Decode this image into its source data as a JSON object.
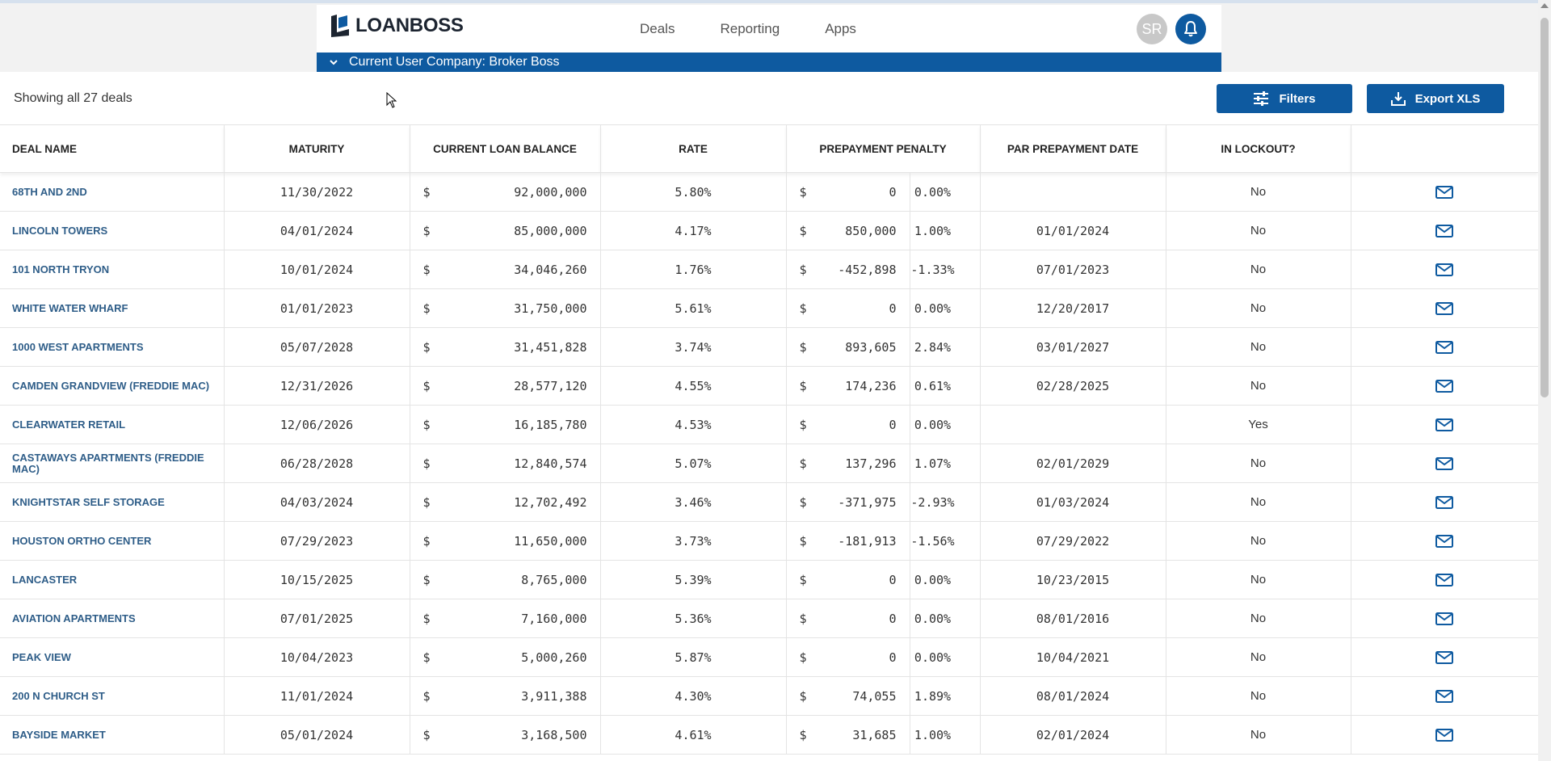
{
  "app": {
    "logo_text": "LOANBOSS"
  },
  "nav": [
    "Deals",
    "Reporting",
    "Apps"
  ],
  "user": {
    "initials": "SR"
  },
  "company_bar": {
    "text": "Current User Company: Broker Boss"
  },
  "toolbar": {
    "showing": "Showing all 27 deals",
    "filters_label": "Filters",
    "export_label": "Export XLS"
  },
  "columns": [
    "DEAL NAME",
    "MATURITY",
    "CURRENT LOAN BALANCE",
    "RATE",
    "PREPAYMENT PENALTY",
    "PAR PREPAYMENT DATE",
    "IN LOCKOUT?",
    ""
  ],
  "currency": "$",
  "rows": [
    {
      "name": "68TH AND 2ND",
      "maturity": "11/30/2022",
      "balance": "92,000,000",
      "rate": "5.80%",
      "pp_amt": "0",
      "pp_pct": "0.00%",
      "par_date": "",
      "lockout": "No"
    },
    {
      "name": "LINCOLN TOWERS",
      "maturity": "04/01/2024",
      "balance": "85,000,000",
      "rate": "4.17%",
      "pp_amt": "850,000",
      "pp_pct": "1.00%",
      "par_date": "01/01/2024",
      "lockout": "No"
    },
    {
      "name": "101 NORTH TRYON",
      "maturity": "10/01/2024",
      "balance": "34,046,260",
      "rate": "1.76%",
      "pp_amt": "-452,898",
      "pp_pct": "-1.33%",
      "par_date": "07/01/2023",
      "lockout": "No"
    },
    {
      "name": "WHITE WATER WHARF",
      "maturity": "01/01/2023",
      "balance": "31,750,000",
      "rate": "5.61%",
      "pp_amt": "0",
      "pp_pct": "0.00%",
      "par_date": "12/20/2017",
      "lockout": "No"
    },
    {
      "name": "1000 WEST APARTMENTS",
      "maturity": "05/07/2028",
      "balance": "31,451,828",
      "rate": "3.74%",
      "pp_amt": "893,605",
      "pp_pct": "2.84%",
      "par_date": "03/01/2027",
      "lockout": "No"
    },
    {
      "name": "CAMDEN GRANDVIEW (FREDDIE MAC)",
      "maturity": "12/31/2026",
      "balance": "28,577,120",
      "rate": "4.55%",
      "pp_amt": "174,236",
      "pp_pct": "0.61%",
      "par_date": "02/28/2025",
      "lockout": "No"
    },
    {
      "name": "CLEARWATER RETAIL",
      "maturity": "12/06/2026",
      "balance": "16,185,780",
      "rate": "4.53%",
      "pp_amt": "0",
      "pp_pct": "0.00%",
      "par_date": "",
      "lockout": "Yes"
    },
    {
      "name": "CASTAWAYS APARTMENTS (FREDDIE MAC)",
      "maturity": "06/28/2028",
      "balance": "12,840,574",
      "rate": "5.07%",
      "pp_amt": "137,296",
      "pp_pct": "1.07%",
      "par_date": "02/01/2029",
      "lockout": "No"
    },
    {
      "name": "KNIGHTSTAR SELF STORAGE",
      "maturity": "04/03/2024",
      "balance": "12,702,492",
      "rate": "3.46%",
      "pp_amt": "-371,975",
      "pp_pct": "-2.93%",
      "par_date": "01/03/2024",
      "lockout": "No"
    },
    {
      "name": "HOUSTON ORTHO CENTER",
      "maturity": "07/29/2023",
      "balance": "11,650,000",
      "rate": "3.73%",
      "pp_amt": "-181,913",
      "pp_pct": "-1.56%",
      "par_date": "07/29/2022",
      "lockout": "No"
    },
    {
      "name": "LANCASTER",
      "maturity": "10/15/2025",
      "balance": "8,765,000",
      "rate": "5.39%",
      "pp_amt": "0",
      "pp_pct": "0.00%",
      "par_date": "10/23/2015",
      "lockout": "No"
    },
    {
      "name": "AVIATION APARTMENTS",
      "maturity": "07/01/2025",
      "balance": "7,160,000",
      "rate": "5.36%",
      "pp_amt": "0",
      "pp_pct": "0.00%",
      "par_date": "08/01/2016",
      "lockout": "No"
    },
    {
      "name": "PEAK VIEW",
      "maturity": "10/04/2023",
      "balance": "5,000,260",
      "rate": "5.87%",
      "pp_amt": "0",
      "pp_pct": "0.00%",
      "par_date": "10/04/2021",
      "lockout": "No"
    },
    {
      "name": "200 N CHURCH ST",
      "maturity": "11/01/2024",
      "balance": "3,911,388",
      "rate": "4.30%",
      "pp_amt": "74,055",
      "pp_pct": "1.89%",
      "par_date": "08/01/2024",
      "lockout": "No"
    },
    {
      "name": "BAYSIDE MARKET",
      "maturity": "05/01/2024",
      "balance": "3,168,500",
      "rate": "4.61%",
      "pp_amt": "31,685",
      "pp_pct": "1.00%",
      "par_date": "02/01/2024",
      "lockout": "No"
    }
  ],
  "colors": {
    "brand": "#0e5aa0",
    "link": "#2e5d88"
  }
}
